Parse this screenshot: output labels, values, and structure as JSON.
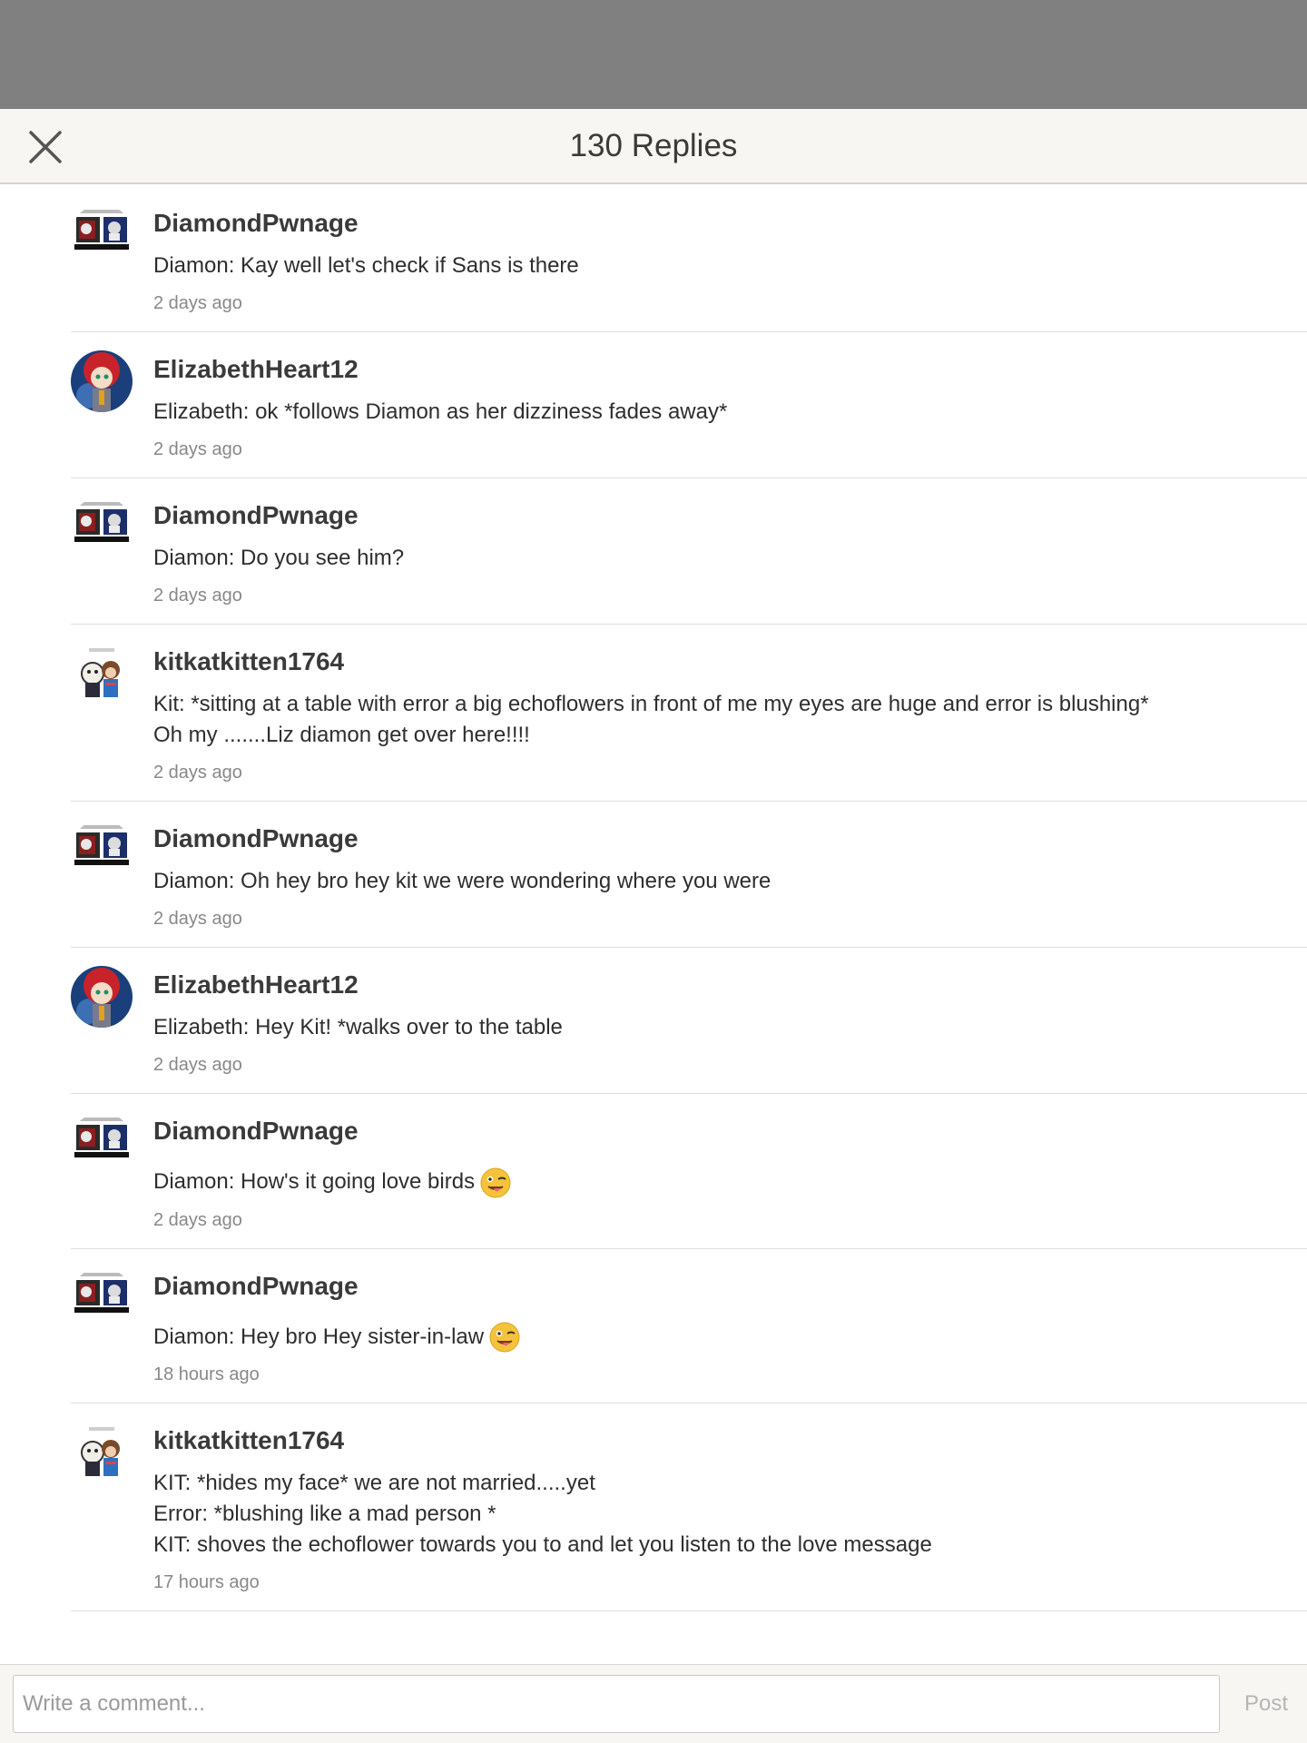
{
  "header": {
    "title": "130 Replies",
    "close_icon": "close-icon"
  },
  "replies": [
    {
      "username": "DiamondPwnage",
      "avatar": "diamond",
      "lines": [
        "Diamon: Kay well let's check if Sans is there"
      ],
      "time": "2 days ago"
    },
    {
      "username": "ElizabethHeart12",
      "avatar": "elizabeth",
      "lines": [
        "Elizabeth: ok *follows Diamon as her dizziness fades away*"
      ],
      "time": "2 days ago"
    },
    {
      "username": "DiamondPwnage",
      "avatar": "diamond",
      "lines": [
        "Diamon: Do you see him?"
      ],
      "time": "2 days ago"
    },
    {
      "username": "kitkatkitten1764",
      "avatar": "kit",
      "lines": [
        "Kit: *sitting at a table with error a big echoflowers in front of me my eyes are huge and error is blushing*",
        "Oh my .......Liz diamon get over here!!!!"
      ],
      "time": "2 days ago"
    },
    {
      "username": "DiamondPwnage",
      "avatar": "diamond",
      "lines": [
        "Diamon: Oh hey bro hey kit we were wondering where you were"
      ],
      "time": "2 days ago"
    },
    {
      "username": "ElizabethHeart12",
      "avatar": "elizabeth",
      "lines": [
        "Elizabeth: Hey Kit! *walks over to the table"
      ],
      "time": "2 days ago"
    },
    {
      "username": "DiamondPwnage",
      "avatar": "diamond",
      "lines": [
        "Diamon: How's it going love birds"
      ],
      "emoji": "winking-tongue-emoji",
      "time": "2 days ago"
    },
    {
      "username": "DiamondPwnage",
      "avatar": "diamond",
      "lines": [
        "Diamon: Hey bro Hey sister-in-law"
      ],
      "emoji": "winking-tongue-emoji",
      "time": "18 hours ago"
    },
    {
      "username": "kitkatkitten1764",
      "avatar": "kit",
      "lines": [
        "KIT: *hides my face* we are not married.....yet",
        "Error: *blushing like a mad person *",
        "KIT: shoves the echoflower towards you to and let you listen to the love message"
      ],
      "time": "17 hours ago"
    }
  ],
  "footer": {
    "placeholder": "Write a comment...",
    "post_label": "Post"
  },
  "colors": {
    "overlay": "#808080",
    "header_bg": "#f7f6f2",
    "text": "#2e2e2e",
    "muted": "#888888"
  }
}
